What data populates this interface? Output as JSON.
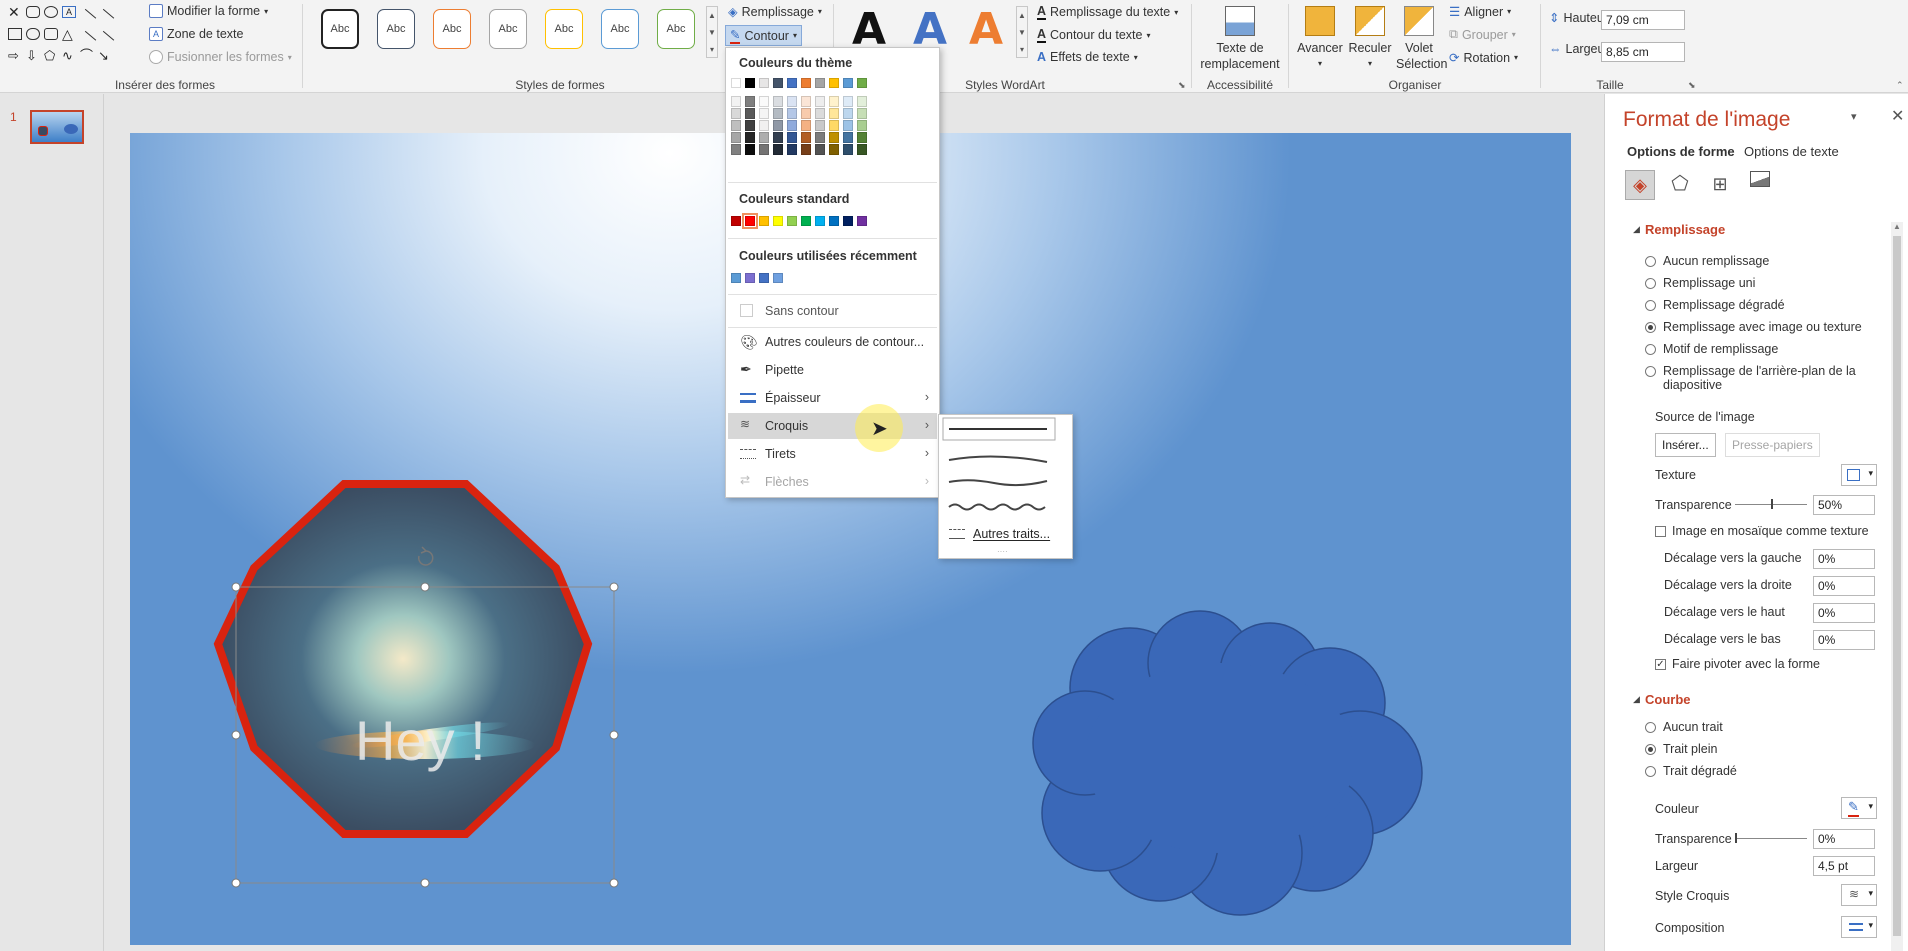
{
  "ribbon": {
    "insert_shapes": {
      "modify_shape": "Modifier la forme",
      "text_box": "Zone de texte",
      "merge_shapes": "Fusionner les formes",
      "label": "Insérer des formes"
    },
    "shape_styles": {
      "label": "Styles de formes",
      "sample_text": "Abc",
      "fill": "Remplissage",
      "outline": "Contour"
    },
    "wordart": {
      "label": "Styles WordArt",
      "letter": "A",
      "text_fill": "Remplissage du texte",
      "text_outline": "Contour du texte",
      "text_effects": "Effets de texte"
    },
    "accessibility": {
      "label": "Accessibilité",
      "alt_text_line1": "Texte de",
      "alt_text_line2": "remplacement"
    },
    "arrange": {
      "label": "Organiser",
      "forward": "Avancer",
      "backward": "Reculer",
      "selection_line1": "Volet",
      "selection_line2": "Sélection",
      "align": "Aligner",
      "group": "Grouper",
      "rotate": "Rotation"
    },
    "size": {
      "label": "Taille",
      "height_label": "Hauteur :",
      "height_value": "7,09 cm",
      "width_label": "Largeur :",
      "width_value": "8,85 cm"
    }
  },
  "slides": {
    "number": "1"
  },
  "slide": {
    "shape_text": "Hey !"
  },
  "outline_menu": {
    "theme_colors_title": "Couleurs du thème",
    "theme_colors": [
      "#ffffff",
      "#000000",
      "#e7e6e6",
      "#44546a",
      "#4472c4",
      "#ed7d31",
      "#a5a5a5",
      "#ffc000",
      "#5b9bd5",
      "#70ad47"
    ],
    "standard_colors_title": "Couleurs standard",
    "standard_colors": [
      "#c00000",
      "#ff0000",
      "#ffc000",
      "#ffff00",
      "#92d050",
      "#00b050",
      "#00b0f0",
      "#0070c0",
      "#002060",
      "#7030a0"
    ],
    "recent_colors_title": "Couleurs utilisées récemment",
    "recent_colors": [
      "#5b9bd5",
      "#7c6fd0",
      "#4472c4",
      "#6fa0e0"
    ],
    "no_outline": "Sans contour",
    "more_colors": "Autres couleurs de contour...",
    "eyedropper": "Pipette",
    "weight": "Épaisseur",
    "sketch": "Croquis",
    "dashes": "Tirets",
    "arrows": "Flèches"
  },
  "sketch_submenu": {
    "more_lines": "Autres traits..."
  },
  "format_pane": {
    "title": "Format de l'image",
    "tab_shape": "Options de forme",
    "tab_text": "Options de texte",
    "fill_section": "Remplissage",
    "fill_options": [
      "Aucun remplissage",
      "Remplissage uni",
      "Remplissage dégradé",
      "Remplissage avec image ou texture",
      "Motif de remplissage",
      "Remplissage de l'arrière-plan de la diapositive"
    ],
    "selected_fill_index": 3,
    "image_source": "Source de l'image",
    "insert_btn": "Insérer...",
    "clipboard_btn": "Presse-papiers",
    "texture": "Texture",
    "transparency": "Transparence",
    "transparency_value": "50%",
    "tile_as_texture": "Image en mosaïque comme texture",
    "offset_left": "Décalage vers la gauche",
    "offset_left_value": "0%",
    "offset_right": "Décalage vers la droite",
    "offset_right_value": "0%",
    "offset_top": "Décalage vers le haut",
    "offset_top_value": "0%",
    "offset_bottom": "Décalage vers le bas",
    "offset_bottom_value": "0%",
    "rotate_with_shape": "Faire pivoter avec la forme",
    "line_section": "Courbe",
    "line_options": [
      "Aucun trait",
      "Trait plein",
      "Trait dégradé"
    ],
    "selected_line_index": 1,
    "color": "Couleur",
    "line_transparency": "Transparence",
    "line_transparency_value": "0%",
    "width": "Largeur",
    "width_value": "4,5 pt",
    "sketch_style": "Style Croquis",
    "compound": "Composition"
  },
  "colors": {
    "accent": "#c4432a",
    "outline_red": "#d9230f",
    "cloud_blue": "#3a68b8"
  }
}
